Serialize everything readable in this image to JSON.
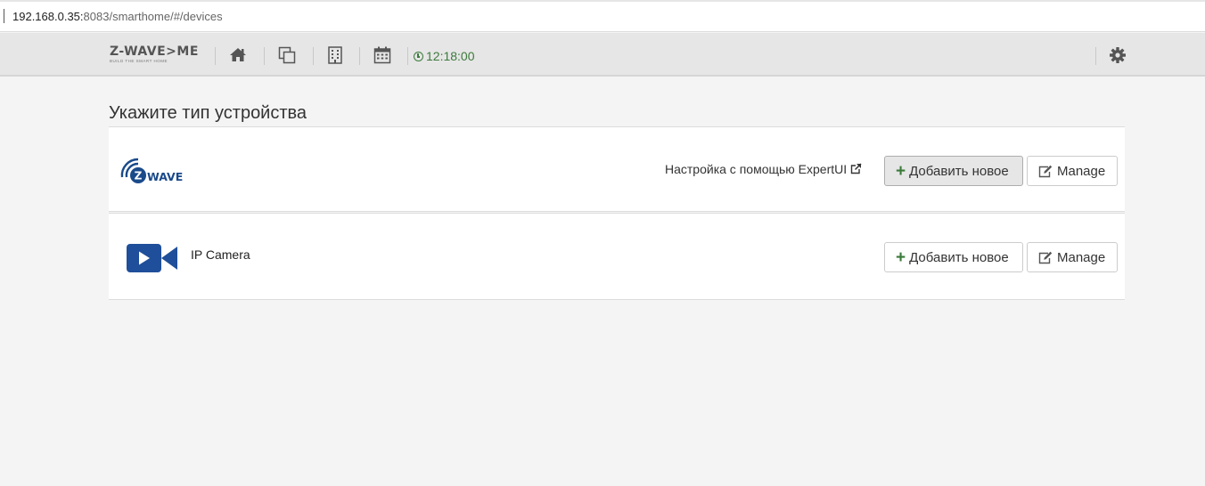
{
  "browser": {
    "url_host": "192.168.0.35:",
    "url_rest": "8083/smarthome/#/devices"
  },
  "nav": {
    "brand": "Z-WAVE>ME",
    "tagline": "BUILD THE SMART HOME",
    "clock": "12:18:00",
    "icons": [
      "home-icon",
      "elements-icon",
      "rooms-icon",
      "events-icon",
      "clock-icon",
      "gear-icon"
    ]
  },
  "content": {
    "title": "Укажите тип устройства",
    "zwave": {
      "logo_text": "WAVE",
      "logo_letter": "Z",
      "expert_link": "Настройка с помощью ExpertUI",
      "add_label": "Добавить новое",
      "manage_label": "Manage"
    },
    "camera": {
      "label": "IP Camera",
      "add_label": "Добавить новое",
      "manage_label": "Manage"
    }
  },
  "colors": {
    "accent_green": "#3c7a3c",
    "zwave_blue": "#1a4a8a",
    "camera_blue": "#1f4f9a"
  }
}
